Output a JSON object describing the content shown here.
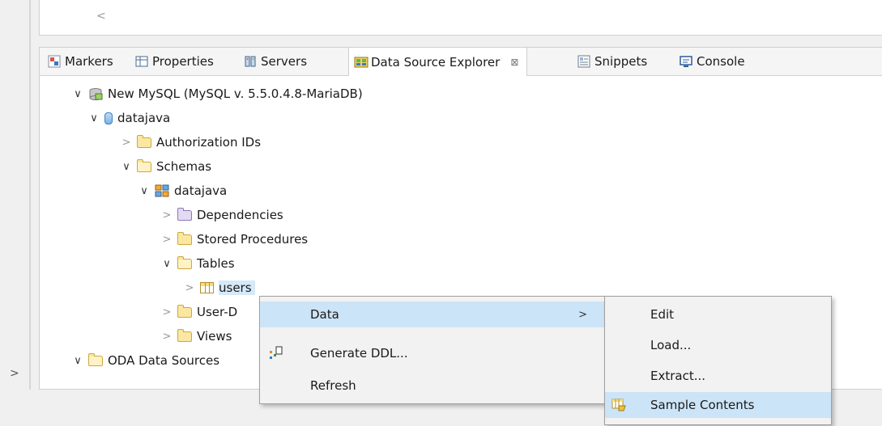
{
  "tabs": [
    {
      "label": "Markers",
      "icon": "markers-icon"
    },
    {
      "label": "Properties",
      "icon": "properties-icon"
    },
    {
      "label": "Servers",
      "icon": "servers-icon"
    },
    {
      "label": "Data Source Explorer",
      "icon": "data-source-explorer-icon",
      "active": true,
      "close": "⊠"
    },
    {
      "label": "Snippets",
      "icon": "snippets-icon"
    },
    {
      "label": "Console",
      "icon": "console-icon"
    }
  ],
  "tree": {
    "connection": "New MySQL (MySQL v. 5.5.0.4.8-MariaDB)",
    "database": "datajava",
    "authorization": "Authorization IDs",
    "schemas": "Schemas",
    "schema": "datajava",
    "dependencies": "Dependencies",
    "stored_procedures": "Stored Procedures",
    "tables": "Tables",
    "users": "users",
    "user_defined": "User-D",
    "views": "Views",
    "oda": "ODA Data Sources"
  },
  "context_menu": {
    "items": [
      "Data",
      "Generate DDL...",
      "Refresh"
    ]
  },
  "submenu": {
    "items": [
      "Edit",
      "Load...",
      "Extract...",
      "Sample Contents"
    ]
  },
  "glyphs": {
    "expanded": "∨",
    "collapsed": ">",
    "submenu_arrow": ">",
    "scroll_left": "<",
    "side_collapse": ">"
  }
}
